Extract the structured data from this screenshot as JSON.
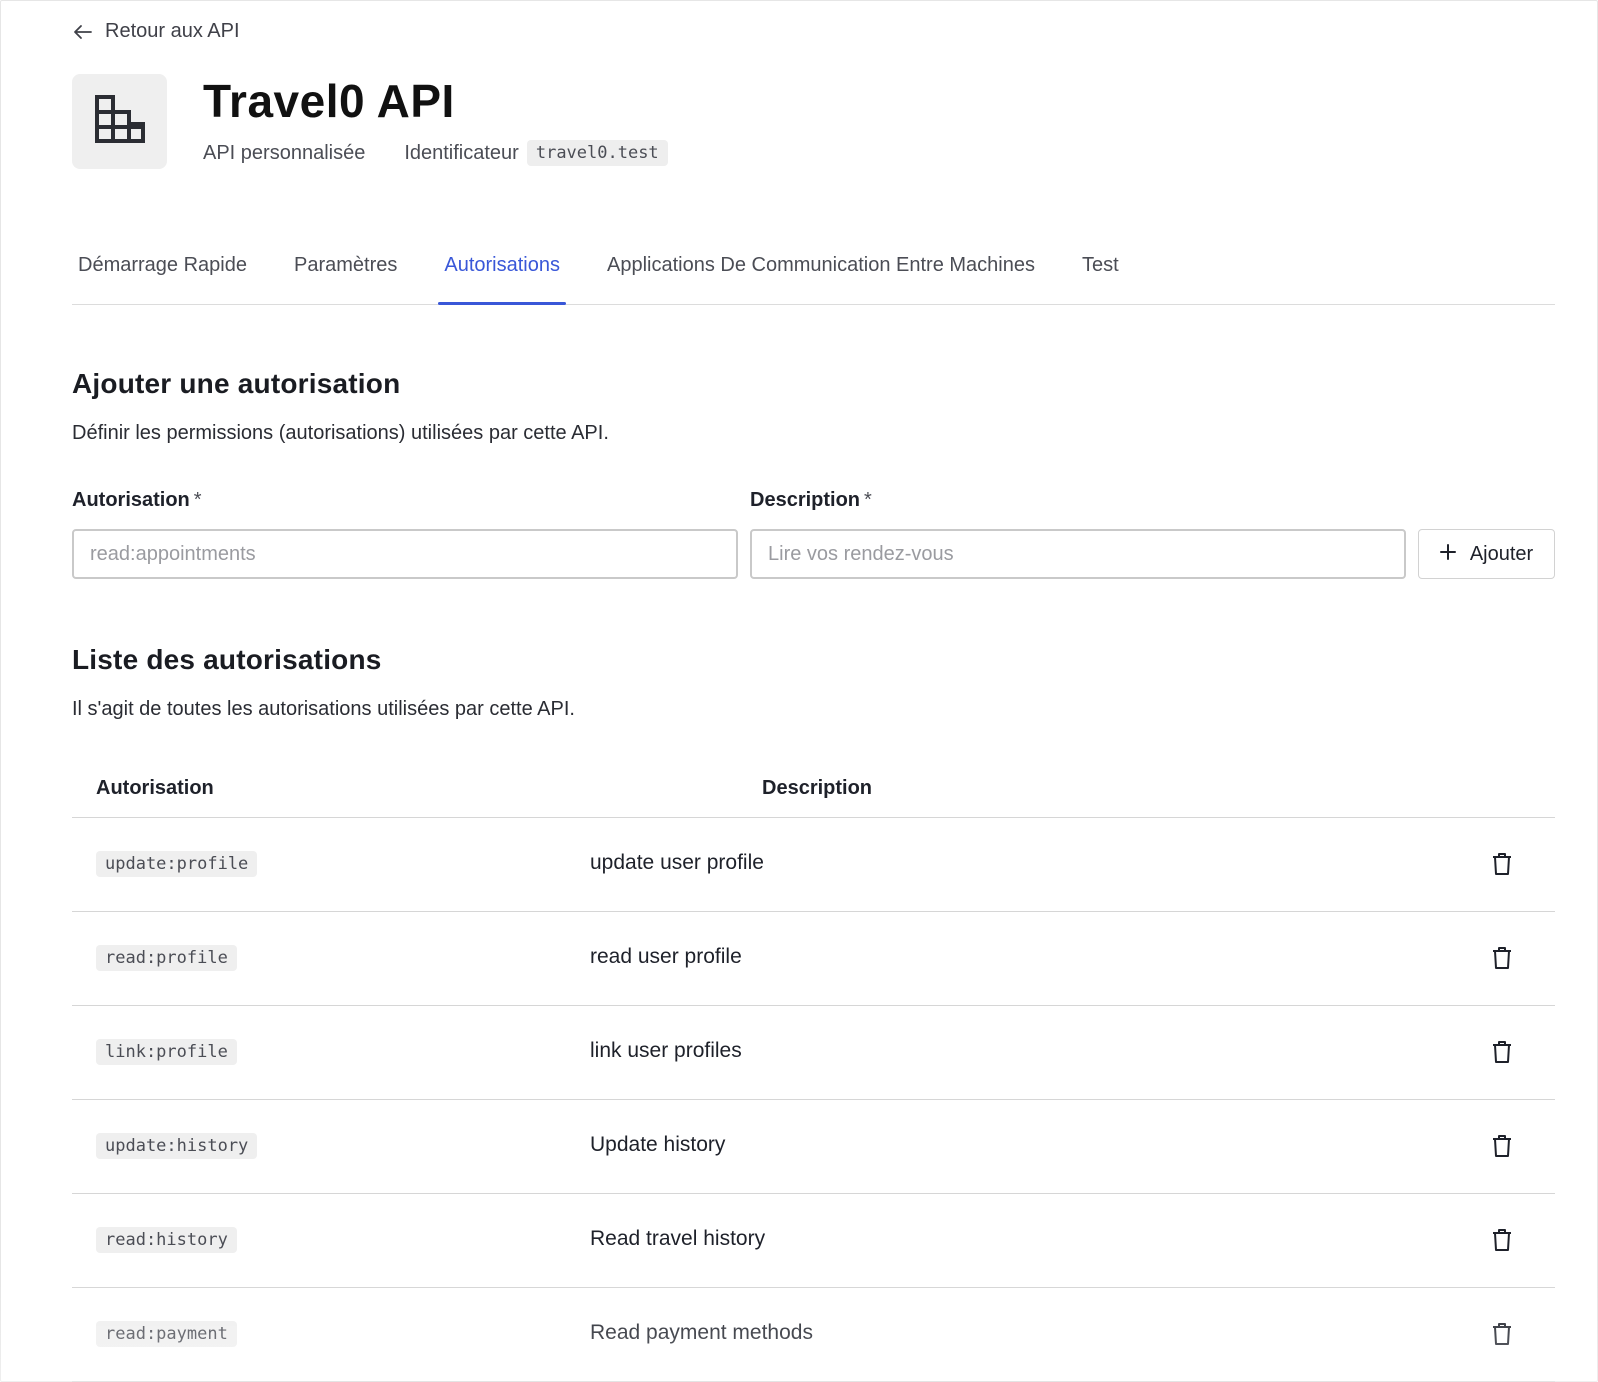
{
  "nav": {
    "back_label": "Retour aux API"
  },
  "header": {
    "title": "Travel0 API",
    "api_type": "API personnalisée",
    "identifier_label": "Identificateur",
    "identifier_value": "travel0.test"
  },
  "tabs": [
    {
      "label": "Démarrage Rapide",
      "active": false
    },
    {
      "label": "Paramètres",
      "active": false
    },
    {
      "label": "Autorisations",
      "active": true
    },
    {
      "label": "Applications De Communication Entre Machines",
      "active": false
    },
    {
      "label": "Test",
      "active": false
    }
  ],
  "add_section": {
    "title": "Ajouter une autorisation",
    "description": "Définir les permissions (autorisations) utilisées par cette API.",
    "permission_label": "Autorisation",
    "permission_placeholder": "read:appointments",
    "permission_value": "",
    "description_label": "Description",
    "description_placeholder": "Lire vos rendez-vous",
    "description_value": "",
    "required_marker": "*",
    "add_button_label": "Ajouter"
  },
  "list_section": {
    "title": "Liste des autorisations",
    "description": "Il s'agit de toutes les autorisations utilisées par cette API.",
    "columns": {
      "permission": "Autorisation",
      "description": "Description"
    },
    "rows": [
      {
        "scope": "update:profile",
        "description": "update user profile"
      },
      {
        "scope": "read:profile",
        "description": "read user profile"
      },
      {
        "scope": "link:profile",
        "description": "link user profiles"
      },
      {
        "scope": "update:history",
        "description": "Update history"
      },
      {
        "scope": "read:history",
        "description": "Read travel history"
      },
      {
        "scope": "read:payment",
        "description": "Read payment methods"
      }
    ]
  },
  "colors": {
    "accent": "#3957d8",
    "text": "#1e212a",
    "muted_text": "#4b4d55",
    "chip_bg": "#efefef",
    "border": "#d6d6d6"
  },
  "icons": {
    "back": "arrow-left-icon",
    "logo": "building-icon",
    "add": "plus-icon",
    "delete": "trash-icon"
  }
}
